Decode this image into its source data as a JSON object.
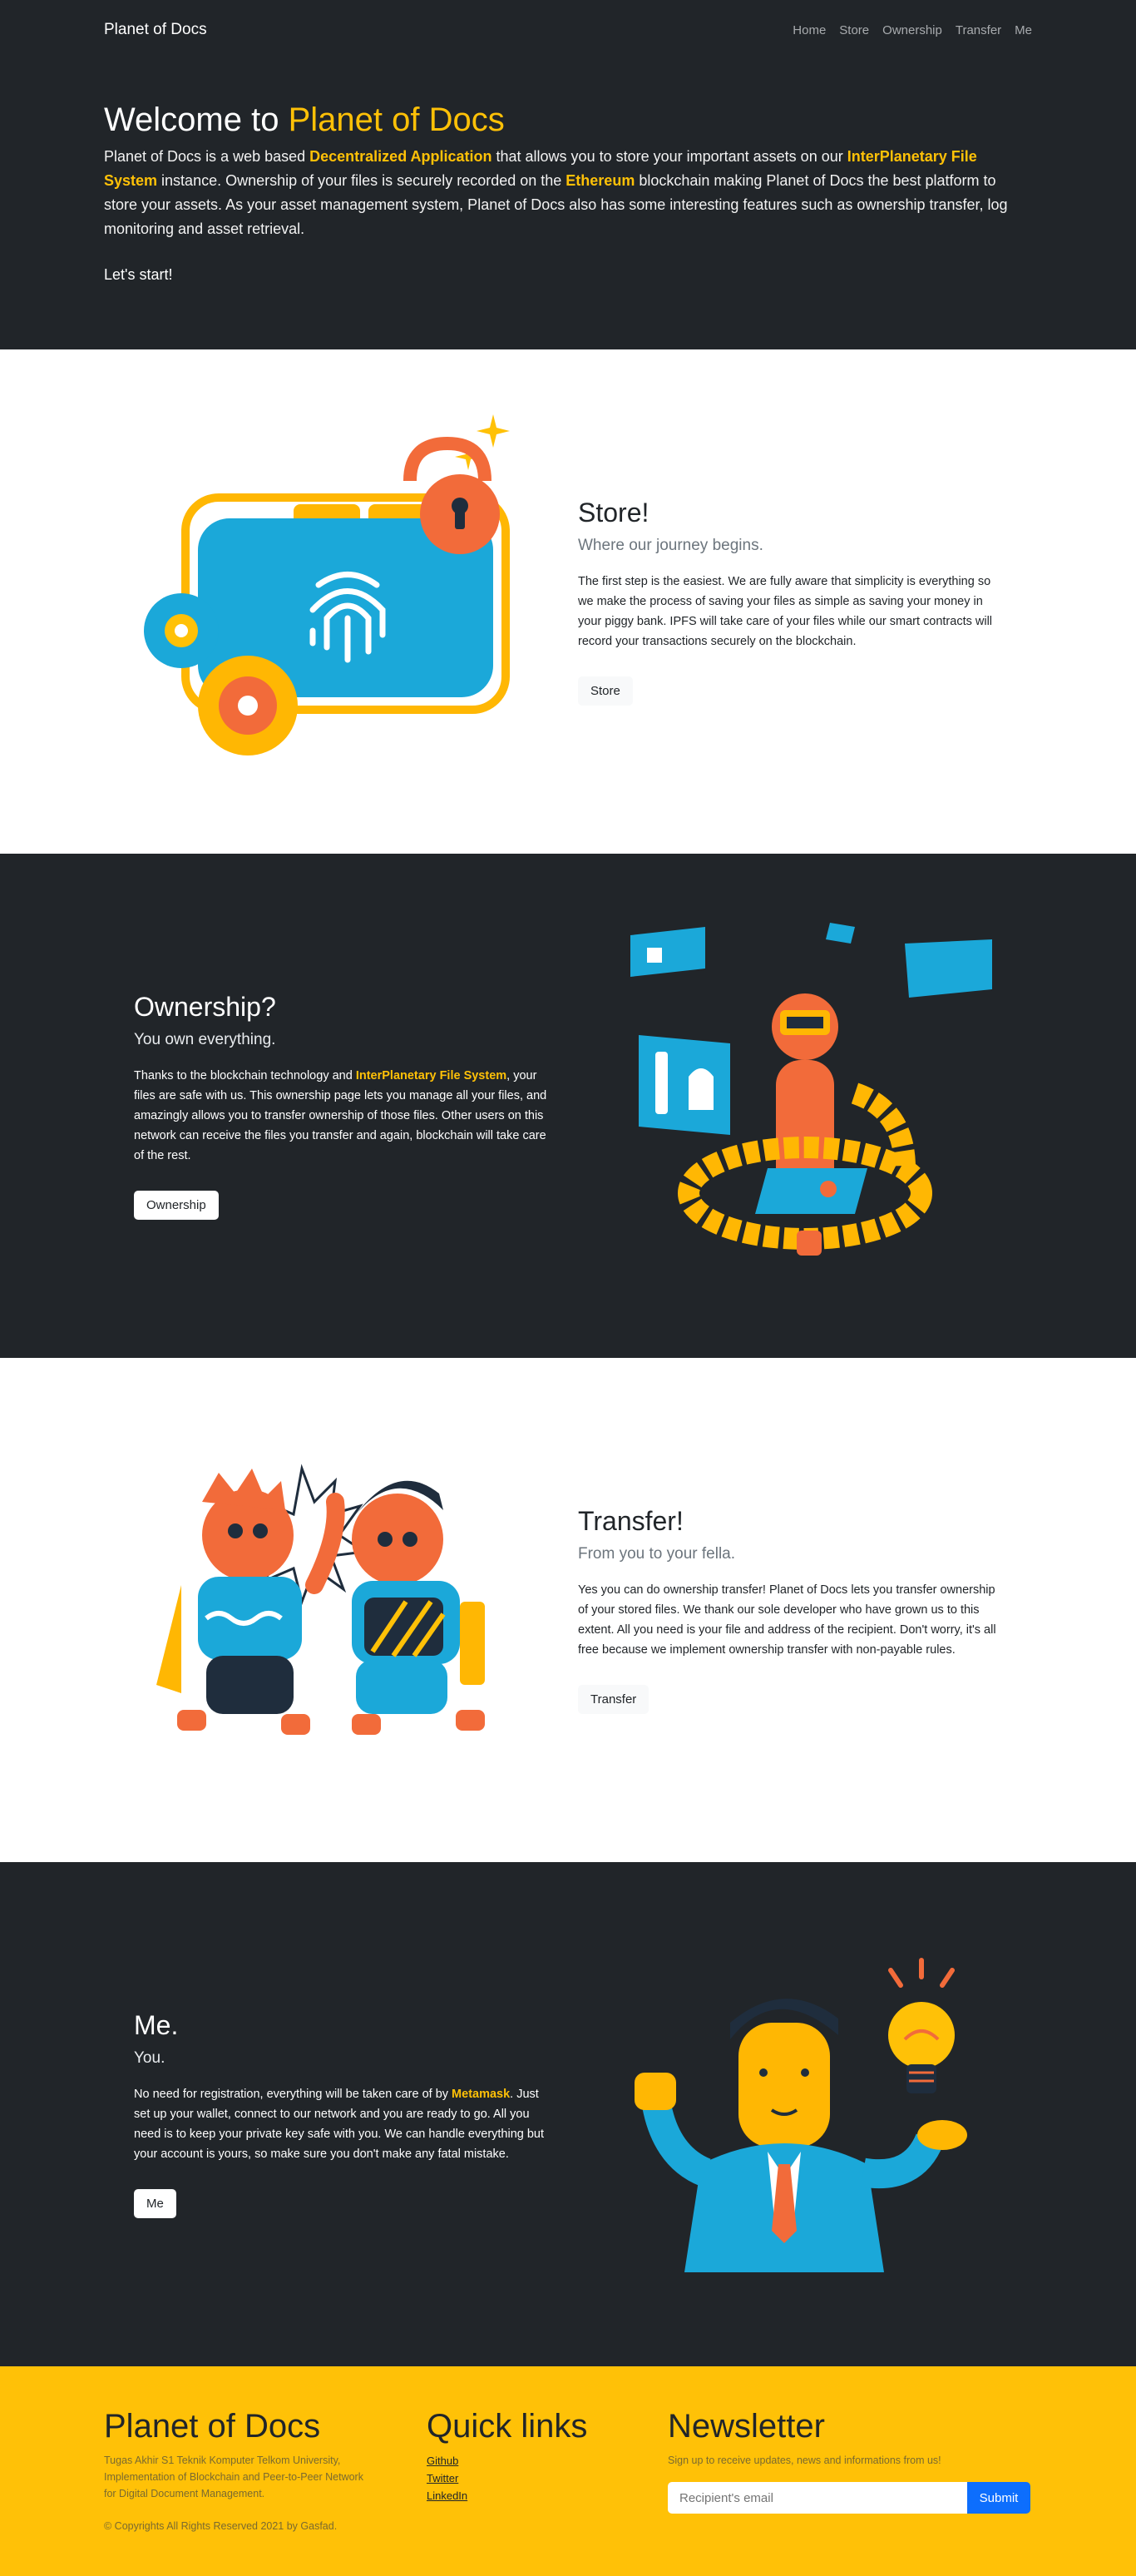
{
  "nav": {
    "brand": "Planet of Docs",
    "links": [
      "Home",
      "Store",
      "Ownership",
      "Transfer",
      "Me"
    ]
  },
  "hero": {
    "title_prefix": "Welcome to ",
    "title_highlight": "Planet of Docs",
    "p1": "Planet of Docs is a web based ",
    "h1": "Decentralized Application",
    "p2": " that allows you to store your important assets on our ",
    "h2": "InterPlanetary File System",
    "p3": " instance. Ownership of your files is securely recorded on the ",
    "h3": "Ethereum",
    "p4": " blockchain making Planet of Docs the best platform to store your assets. As your asset management system, Planet of Docs also has some interesting features such as ownership transfer, log monitoring and asset retrieval.",
    "start": "Let's start!"
  },
  "store": {
    "title": "Store!",
    "subtitle": "Where our journey begins.",
    "body": "The first step is the easiest. We are fully aware that simplicity is everything so we make the process of saving your files as simple as saving your money in your piggy bank. IPFS will take care of your files while our smart contracts will record your transactions securely on the blockchain.",
    "button": "Store"
  },
  "ownership": {
    "title": "Ownership?",
    "subtitle": "You own everything.",
    "b1": "Thanks to the blockchain technology and ",
    "bh": "InterPlanetary File System",
    "b2": ", your files are safe with us. This ownership page lets you manage all your files, and amazingly allows you to transfer ownership of those files. Other users on this network can receive the files you transfer and again, blockchain will take care of the rest.",
    "button": "Ownership"
  },
  "transfer": {
    "title": "Transfer!",
    "subtitle": "From you to your fella.",
    "body": "Yes you can do ownership transfer! Planet of Docs lets you transfer ownership of your stored files. We thank our sole developer who have grown us to this extent. All you need is your file and address of the recipient. Don't worry, it's all free because we implement ownership transfer with non-payable rules.",
    "button": "Transfer"
  },
  "me": {
    "title": "Me.",
    "subtitle": "You.",
    "b1": "No need for registration, everything will be taken care of by ",
    "bh": "Metamask",
    "b2": ". Just set up your wallet, connect to our network and you are ready to go. All you need is to keep your private key safe with you. We can handle everything but your account is yours, so make sure you don't make any fatal mistake.",
    "button": "Me"
  },
  "footer": {
    "brand": "Planet of Docs",
    "desc": "Tugas Akhir S1 Teknik Komputer Telkom University, Implementation of Blockchain and Peer-to-Peer Network for Digital Document Management.",
    "copyright": "© Copyrights All Rights Reserved 2021 by Gasfad.",
    "links_title": "Quick links",
    "links": [
      "Github",
      "Twitter",
      "LinkedIn"
    ],
    "news_title": "Newsletter",
    "news_desc": "Sign up to receive updates, news and informations from us!",
    "news_placeholder": "Recipient's email",
    "news_button": "Submit"
  }
}
